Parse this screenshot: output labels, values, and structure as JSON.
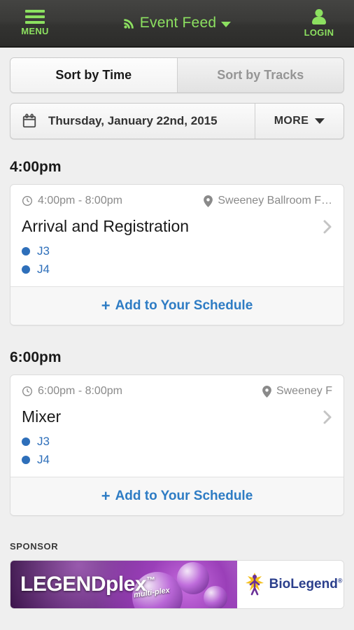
{
  "header": {
    "menu_label": "MENU",
    "menu_icon": "hamburger-icon",
    "title": "Event Feed",
    "title_icon": "rss-icon",
    "title_caret": "caret-down-icon",
    "login_label": "LOGIN",
    "login_icon": "person-icon",
    "background_color": "#363634",
    "accent_color": "#8ce060"
  },
  "sort_tabs": [
    {
      "label": "Sort by Time",
      "active": true
    },
    {
      "label": "Sort by Tracks",
      "active": false
    }
  ],
  "date_bar": {
    "icon": "calendar-icon",
    "date": "Thursday, January 22nd, 2015",
    "more_label": "MORE",
    "more_icon": "chevron-down-icon"
  },
  "schedule": [
    {
      "time_heading": "4:00pm",
      "event": {
        "time_range": "4:00pm - 8:00pm",
        "time_icon": "clock-icon",
        "location": "Sweeney Ballroom F…",
        "location_icon": "map-pin-icon",
        "title": "Arrival and Registration",
        "disclosure_icon": "chevron-right-icon",
        "tracks": [
          {
            "label": "J3",
            "color": "#2e6fba"
          },
          {
            "label": "J4",
            "color": "#2e6fba"
          }
        ],
        "add_label": "Add to Your Schedule",
        "add_icon": "plus-icon"
      }
    },
    {
      "time_heading": "6:00pm",
      "event": {
        "time_range": "6:00pm - 8:00pm",
        "time_icon": "clock-icon",
        "location": "Sweeney F",
        "location_icon": "map-pin-icon",
        "title": "Mixer",
        "disclosure_icon": "chevron-right-icon",
        "tracks": [
          {
            "label": "J3",
            "color": "#2e6fba"
          },
          {
            "label": "J4",
            "color": "#2e6fba"
          }
        ],
        "add_label": "Add to Your Schedule",
        "add_icon": "plus-icon"
      }
    }
  ],
  "sponsor": {
    "section_label": "SPONSOR",
    "product_name": "LEGENDplex",
    "product_tm": "™",
    "product_tagline": "multi-plex",
    "company_name": "BioLegend",
    "company_mark": "®"
  }
}
